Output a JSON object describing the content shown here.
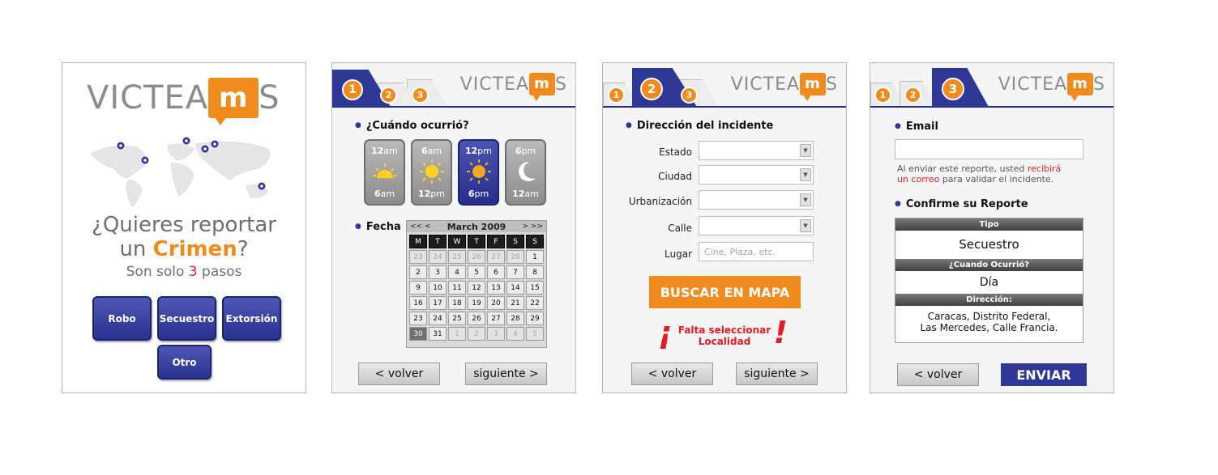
{
  "brand": {
    "logo_left": "VICTEA",
    "logo_mark": "m",
    "logo_right": "S"
  },
  "panel1": {
    "headline_line1": "¿Quieres reportar",
    "headline_line2_pre": "un ",
    "headline_line2_accent": "Crimen",
    "headline_line2_post": "?",
    "sub_pre": "Son solo ",
    "sub_num": "3",
    "sub_post": " pasos",
    "buttons": [
      "Robo",
      "Secuestro",
      "Extorsión",
      "Otro"
    ]
  },
  "tabs": [
    "1",
    "2",
    "3"
  ],
  "panel2": {
    "when_title": "¿Cuándo ocurrió?",
    "time_cards": [
      {
        "from_n": "12",
        "from_s": "am",
        "to_n": "6",
        "to_s": "am",
        "icon": "sunrise-icon",
        "selected": false
      },
      {
        "from_n": "6",
        "from_s": "am",
        "to_n": "12",
        "to_s": "pm",
        "icon": "sun-icon",
        "selected": false
      },
      {
        "from_n": "12",
        "from_s": "pm",
        "to_n": "6",
        "to_s": "pm",
        "icon": "sun-icon",
        "selected": true
      },
      {
        "from_n": "6",
        "from_s": "pm",
        "to_n": "12",
        "to_s": "am",
        "icon": "moon-icon",
        "selected": false
      }
    ],
    "date_label": "Fecha",
    "calendar": {
      "prev": "<< <",
      "month": "March 2009",
      "next": "> >>",
      "weekdays": [
        "M",
        "T",
        "W",
        "T",
        "F",
        "S",
        "S"
      ],
      "days": [
        {
          "d": "23",
          "dim": true
        },
        {
          "d": "24",
          "dim": true
        },
        {
          "d": "25",
          "dim": true
        },
        {
          "d": "26",
          "dim": true
        },
        {
          "d": "27",
          "dim": true
        },
        {
          "d": "28",
          "dim": true
        },
        {
          "d": "1"
        },
        {
          "d": "2"
        },
        {
          "d": "3"
        },
        {
          "d": "4"
        },
        {
          "d": "5"
        },
        {
          "d": "6"
        },
        {
          "d": "7"
        },
        {
          "d": "8"
        },
        {
          "d": "9"
        },
        {
          "d": "10"
        },
        {
          "d": "11"
        },
        {
          "d": "12"
        },
        {
          "d": "13"
        },
        {
          "d": "14"
        },
        {
          "d": "15"
        },
        {
          "d": "16"
        },
        {
          "d": "17"
        },
        {
          "d": "18"
        },
        {
          "d": "19"
        },
        {
          "d": "20"
        },
        {
          "d": "21"
        },
        {
          "d": "22"
        },
        {
          "d": "23"
        },
        {
          "d": "24"
        },
        {
          "d": "25"
        },
        {
          "d": "26"
        },
        {
          "d": "27"
        },
        {
          "d": "28"
        },
        {
          "d": "29"
        },
        {
          "d": "30",
          "sel": true
        },
        {
          "d": "31"
        },
        {
          "d": "1",
          "dim": true
        },
        {
          "d": "2",
          "dim": true
        },
        {
          "d": "3",
          "dim": true
        },
        {
          "d": "4",
          "dim": true
        },
        {
          "d": "5",
          "dim": true
        }
      ]
    },
    "back_label": "< volver",
    "next_label": "siguiente >"
  },
  "panel3": {
    "title": "Dirección del incidente",
    "fields": [
      "Estado",
      "Ciudad",
      "Urbanización",
      "Calle"
    ],
    "place_label": "Lugar",
    "place_placeholder": "Cine, Plaza, etc.",
    "map_button": "BUSCAR EN MAPA",
    "warning_line1": "Falta seleccionar",
    "warning_line2": "Localidad",
    "warning_open": "¡",
    "warning_close": "!",
    "back_label": "< volver",
    "next_label": "siguiente >"
  },
  "panel4": {
    "email_title": "Email",
    "note_pre": "Al enviar este reporte, usted ",
    "note_red1": "recibirá",
    "note_red2": "un correo",
    "note_post": " para validar el incidente.",
    "confirm_title": "Confirme su Reporte",
    "type_head": "Tipo",
    "type_val": "Secuestro",
    "when_head": "¿Cuando Ocurrió?",
    "when_val": "Día",
    "addr_head": "Dirección:",
    "addr_line1": "Caracas, Distrito Federal,",
    "addr_line2": "Las Mercedes, Calle Francia.",
    "back_label": "< volver",
    "send_label": "ENVIAR"
  },
  "colors": {
    "brand_orange": "#f08b1d",
    "brand_blue": "#2f3895",
    "warning_red": "#e31e24"
  }
}
